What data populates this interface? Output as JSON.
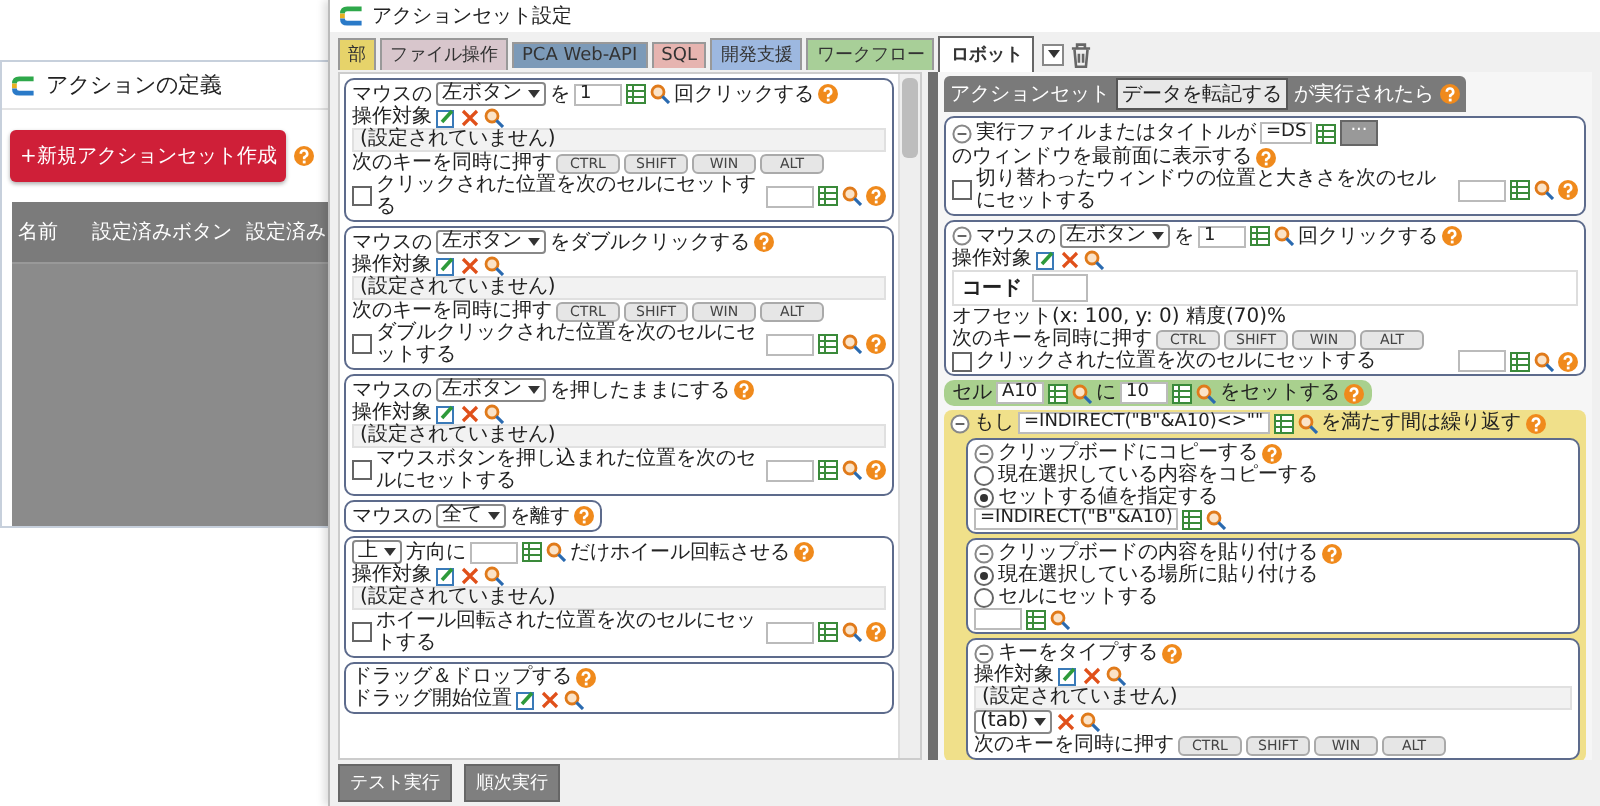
{
  "main_window": {
    "title": "アクションの定義",
    "new_button": "+新規アクションセット作成",
    "table": {
      "columns": [
        "名前",
        "設定済みボタン",
        "設定済み"
      ]
    }
  },
  "settings_window": {
    "title": "アクションセット設定",
    "tabs": [
      {
        "label": "部",
        "color": "#e6d36a",
        "selected": false
      },
      {
        "label": "ファイル操作",
        "color": "#d8c6cc",
        "selected": false
      },
      {
        "label": "PCA Web-API",
        "color": "#7c9ab8",
        "selected": false
      },
      {
        "label": "SQL",
        "color": "#e6b4b0",
        "selected": false
      },
      {
        "label": "開発支援",
        "color": "#9db8e0",
        "selected": false
      },
      {
        "label": "ワークフロー",
        "color": "#a8cf98",
        "selected": false
      },
      {
        "label": "ロボット",
        "color": "#ffffff",
        "selected": true
      }
    ],
    "palette": [
      {
        "kind": "card",
        "rows": [
          {
            "parts": [
              {
                "kind": "text",
                "text": "マウスの"
              },
              {
                "kind": "select",
                "value": "左ボタン"
              },
              {
                "kind": "text",
                "text": "を"
              },
              {
                "kind": "input",
                "value": "1"
              },
              {
                "kind": "pick"
              },
              {
                "kind": "text",
                "text": "回クリックする"
              },
              {
                "kind": "help"
              }
            ]
          },
          {
            "parts": [
              {
                "kind": "text",
                "text": "操作対象"
              },
              {
                "kind": "edit"
              },
              {
                "kind": "delete"
              },
              {
                "kind": "search"
              }
            ]
          },
          {
            "parts": [
              {
                "kind": "note",
                "text": "(設定されていません)"
              }
            ]
          },
          {
            "parts": [
              {
                "kind": "text",
                "text": "次のキーを同時に押す"
              },
              {
                "kind": "keys",
                "labels": [
                  "CTRL",
                  "SHIFT",
                  "WIN",
                  "ALT"
                ]
              }
            ]
          },
          {
            "parts": [
              {
                "kind": "checkbox",
                "checked": false,
                "label": "クリックされた位置を次のセルにセットする"
              },
              {
                "kind": "input"
              },
              {
                "kind": "pick"
              },
              {
                "kind": "help"
              }
            ]
          }
        ]
      },
      {
        "kind": "card",
        "rows": [
          {
            "parts": [
              {
                "kind": "text",
                "text": "マウスの"
              },
              {
                "kind": "select",
                "value": "左ボタン"
              },
              {
                "kind": "text",
                "text": "をダブルクリックする"
              },
              {
                "kind": "help"
              }
            ]
          },
          {
            "parts": [
              {
                "kind": "text",
                "text": "操作対象"
              },
              {
                "kind": "edit"
              },
              {
                "kind": "delete"
              },
              {
                "kind": "search"
              }
            ]
          },
          {
            "parts": [
              {
                "kind": "note",
                "text": "(設定されていません)"
              }
            ]
          },
          {
            "parts": [
              {
                "kind": "text",
                "text": "次のキーを同時に押す"
              },
              {
                "kind": "keys",
                "labels": [
                  "CTRL",
                  "SHIFT",
                  "WIN",
                  "ALT"
                ]
              }
            ]
          },
          {
            "parts": [
              {
                "kind": "checkbox",
                "checked": false,
                "label": "ダブルクリックされた位置を次のセルにセットする"
              },
              {
                "kind": "input"
              },
              {
                "kind": "pick"
              },
              {
                "kind": "help"
              }
            ]
          }
        ]
      },
      {
        "kind": "card",
        "rows": [
          {
            "parts": [
              {
                "kind": "text",
                "text": "マウスの"
              },
              {
                "kind": "select",
                "value": "左ボタン"
              },
              {
                "kind": "text",
                "text": "を押したままにする"
              },
              {
                "kind": "help"
              }
            ]
          },
          {
            "parts": [
              {
                "kind": "text",
                "text": "操作対象"
              },
              {
                "kind": "edit"
              },
              {
                "kind": "delete"
              },
              {
                "kind": "search"
              }
            ]
          },
          {
            "parts": [
              {
                "kind": "note",
                "text": "(設定されていません)"
              }
            ]
          },
          {
            "parts": [
              {
                "kind": "checkbox",
                "checked": false,
                "label": "マウスボタンを押し込まれた位置を次のセルにセットする"
              },
              {
                "kind": "input"
              },
              {
                "kind": "pick"
              },
              {
                "kind": "help"
              }
            ]
          }
        ]
      },
      {
        "kind": "compact",
        "rows": [
          {
            "parts": [
              {
                "kind": "text",
                "text": "マウスの"
              },
              {
                "kind": "select",
                "value": "全て"
              },
              {
                "kind": "text",
                "text": "を離す"
              },
              {
                "kind": "help"
              }
            ]
          }
        ]
      },
      {
        "kind": "card",
        "rows": [
          {
            "parts": [
              {
                "kind": "select",
                "value": "上"
              },
              {
                "kind": "text",
                "text": "方向に"
              },
              {
                "kind": "input"
              },
              {
                "kind": "pick"
              },
              {
                "kind": "text",
                "text": "だけホイール回転させる"
              },
              {
                "kind": "help"
              }
            ]
          },
          {
            "parts": [
              {
                "kind": "text",
                "text": "操作対象"
              },
              {
                "kind": "edit"
              },
              {
                "kind": "delete"
              },
              {
                "kind": "search"
              }
            ]
          },
          {
            "parts": [
              {
                "kind": "note",
                "text": "(設定されていません)"
              }
            ]
          },
          {
            "parts": [
              {
                "kind": "checkbox",
                "checked": false,
                "label": "ホイール回転された位置を次のセルにセットする"
              },
              {
                "kind": "input"
              },
              {
                "kind": "pick"
              },
              {
                "kind": "help"
              }
            ]
          }
        ]
      },
      {
        "kind": "card",
        "rows": [
          {
            "parts": [
              {
                "kind": "text",
                "text": "ドラッグ＆ドロップする"
              },
              {
                "kind": "help"
              }
            ]
          },
          {
            "parts": [
              {
                "kind": "text",
                "text": "ドラッグ開始位置"
              },
              {
                "kind": "edit"
              },
              {
                "kind": "delete"
              },
              {
                "kind": "search"
              }
            ]
          }
        ]
      }
    ],
    "action_set": {
      "label": "アクションセット",
      "trigger": "データを転記する",
      "suffix": "が実行されたら",
      "items": [
        {
          "kind": "card",
          "rows": [
            {
              "parts": [
                {
                  "kind": "collapse"
                },
                {
                  "kind": "text",
                  "text": "実行ファイルまたはタイトルが"
                },
                {
                  "kind": "input",
                  "value": "=DS"
                },
                {
                  "kind": "grid"
                },
                {
                  "kind": "button",
                  "label": "..."
                },
                {
                  "kind": "text",
                  "text": "のウィンドウを最前面に表示する"
                },
                {
                  "kind": "help"
                }
              ]
            },
            {
              "parts": [
                {
                  "kind": "checkbox",
                  "checked": false,
                  "label": "切り替わったウィンドウの位置と大きさを次のセルにセットする"
                },
                {
                  "kind": "input"
                },
                {
                  "kind": "pick"
                },
                {
                  "kind": "help"
                }
              ]
            }
          ]
        },
        {
          "kind": "card",
          "rows": [
            {
              "parts": [
                {
                  "kind": "collapse"
                },
                {
                  "kind": "text",
                  "text": "マウスの"
                },
                {
                  "kind": "select",
                  "value": "左ボタン"
                },
                {
                  "kind": "text",
                  "text": "を"
                },
                {
                  "kind": "input",
                  "value": "1"
                },
                {
                  "kind": "pick"
                },
                {
                  "kind": "text",
                  "text": "回クリックする"
                },
                {
                  "kind": "help"
                }
              ]
            },
            {
              "parts": [
                {
                  "kind": "text",
                  "text": "操作対象"
                },
                {
                  "kind": "edit"
                },
                {
                  "kind": "delete"
                },
                {
                  "kind": "search"
                }
              ]
            },
            {
              "parts": [
                {
                  "kind": "codebox",
                  "label": "コード"
                }
              ]
            },
            {
              "parts": [
                {
                  "kind": "text",
                  "text": "オフセット(x: 100, y: 0) 精度(70)%"
                }
              ]
            },
            {
              "parts": [
                {
                  "kind": "text",
                  "text": "次のキーを同時に押す"
                },
                {
                  "kind": "keys",
                  "labels": [
                    "CTRL",
                    "SHIFT",
                    "WIN",
                    "ALT"
                  ]
                }
              ]
            },
            {
              "parts": [
                {
                  "kind": "checkbox",
                  "checked": false,
                  "label": "クリックされた位置を次のセルにセットする"
                },
                {
                  "kind": "input"
                },
                {
                  "kind": "pick"
                },
                {
                  "kind": "help"
                }
              ]
            }
          ]
        },
        {
          "kind": "cell",
          "rows": [
            {
              "parts": [
                {
                  "kind": "text",
                  "text": "セル"
                },
                {
                  "kind": "input",
                  "value": "A10"
                },
                {
                  "kind": "pick"
                },
                {
                  "kind": "text",
                  "text": "に"
                },
                {
                  "kind": "input",
                  "value": "10"
                },
                {
                  "kind": "pick"
                },
                {
                  "kind": "text",
                  "text": "をセットする"
                },
                {
                  "kind": "help"
                }
              ]
            }
          ]
        },
        {
          "kind": "loop",
          "rows": [
            {
              "parts": [
                {
                  "kind": "collapse"
                },
                {
                  "kind": "text",
                  "text": "もし"
                },
                {
                  "kind": "input",
                  "value": "=INDIRECT(\"B\"&A10)<>\"\""
                },
                {
                  "kind": "pick"
                },
                {
                  "kind": "text",
                  "text": "を満たす間は繰り返す"
                },
                {
                  "kind": "help"
                }
              ]
            }
          ],
          "children": [
            {
              "kind": "card",
              "rows": [
                {
                  "parts": [
                    {
                      "kind": "collapse"
                    },
                    {
                      "kind": "text",
                      "text": "クリップボードにコピーする"
                    },
                    {
                      "kind": "help"
                    }
                  ]
                },
                {
                  "parts": [
                    {
                      "kind": "radio",
                      "selected": false,
                      "label": "現在選択している内容をコピーする"
                    }
                  ]
                },
                {
                  "parts": [
                    {
                      "kind": "radio",
                      "selected": true,
                      "label": "セットする値を指定する"
                    }
                  ]
                },
                {
                  "parts": [
                    {
                      "kind": "input",
                      "value": "=INDIRECT(\"B\"&A10)"
                    },
                    {
                      "kind": "pick"
                    }
                  ]
                }
              ]
            },
            {
              "kind": "card",
              "rows": [
                {
                  "parts": [
                    {
                      "kind": "collapse"
                    },
                    {
                      "kind": "text",
                      "text": "クリップボードの内容を貼り付ける"
                    },
                    {
                      "kind": "help"
                    }
                  ]
                },
                {
                  "parts": [
                    {
                      "kind": "radio",
                      "selected": true,
                      "label": "現在選択している場所に貼り付ける"
                    }
                  ]
                },
                {
                  "parts": [
                    {
                      "kind": "radio",
                      "selected": false,
                      "label": "セルにセットする"
                    }
                  ]
                },
                {
                  "parts": [
                    {
                      "kind": "input"
                    },
                    {
                      "kind": "pick"
                    }
                  ]
                }
              ]
            },
            {
              "kind": "card",
              "rows": [
                {
                  "parts": [
                    {
                      "kind": "collapse"
                    },
                    {
                      "kind": "text",
                      "text": "キーをタイプする"
                    },
                    {
                      "kind": "help"
                    }
                  ]
                },
                {
                  "parts": [
                    {
                      "kind": "text",
                      "text": "操作対象"
                    },
                    {
                      "kind": "edit"
                    },
                    {
                      "kind": "delete"
                    },
                    {
                      "kind": "search"
                    }
                  ]
                },
                {
                  "parts": [
                    {
                      "kind": "note",
                      "text": "(設定されていません)"
                    }
                  ]
                },
                {
                  "parts": [
                    {
                      "kind": "select",
                      "value": "(tab)"
                    },
                    {
                      "kind": "delete"
                    },
                    {
                      "kind": "search"
                    }
                  ]
                },
                {
                  "parts": [
                    {
                      "kind": "text",
                      "text": "次のキーを同時に押す"
                    },
                    {
                      "kind": "keys",
                      "labels": [
                        "CTRL",
                        "SHIFT",
                        "WIN",
                        "ALT"
                      ]
                    }
                  ]
                }
              ]
            }
          ]
        }
      ]
    },
    "buttons": [
      "テスト実行",
      "順次実行"
    ]
  }
}
